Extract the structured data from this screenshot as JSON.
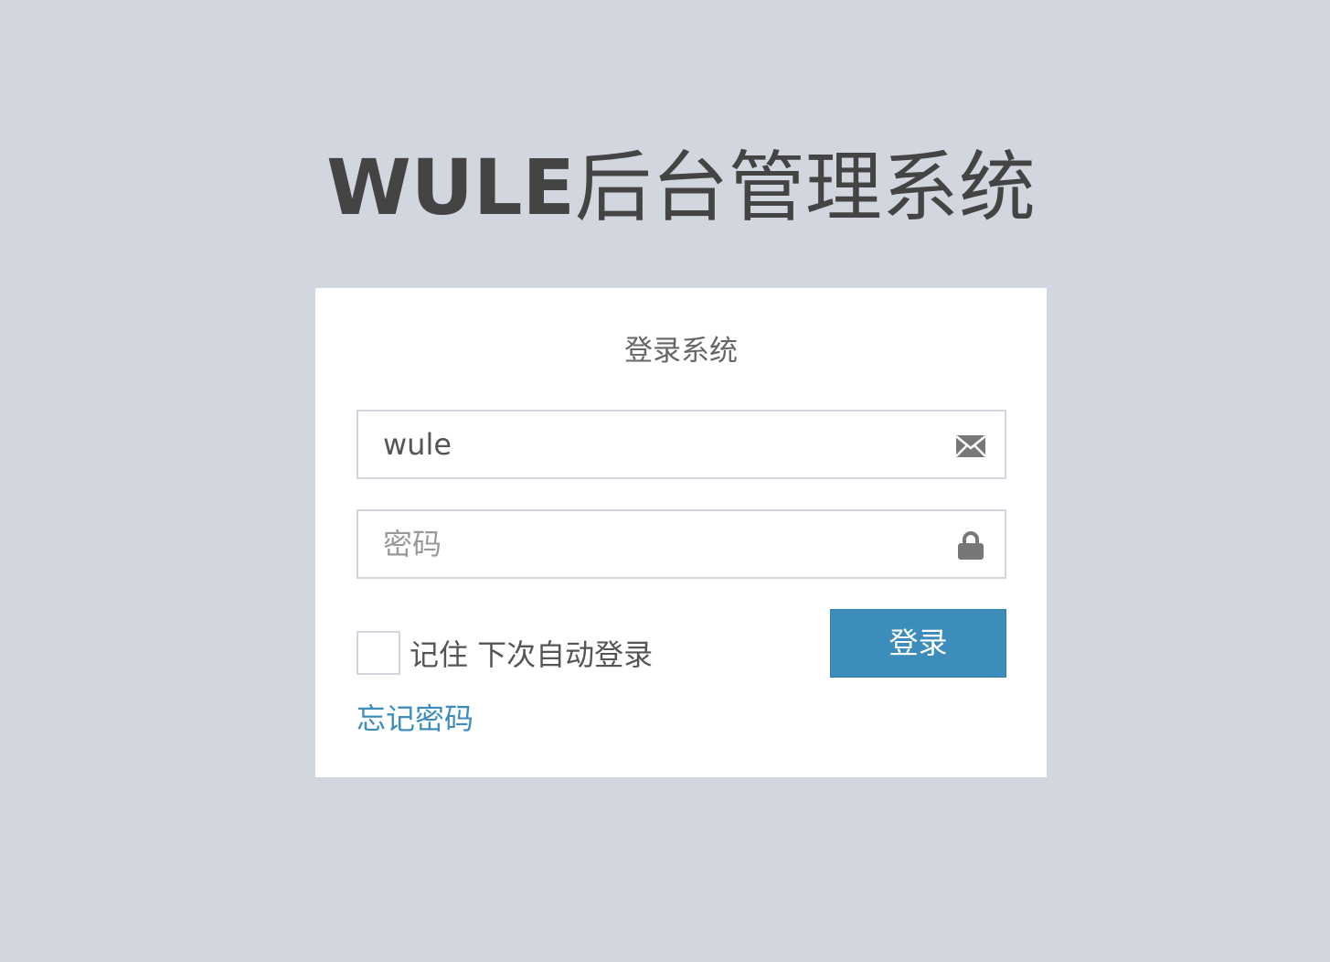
{
  "logo": {
    "bold": "WULE",
    "light": "后台管理系统"
  },
  "form": {
    "title": "登录系统",
    "username": {
      "value": "wule",
      "icon": "envelope-icon"
    },
    "password": {
      "value": "",
      "placeholder": "密码",
      "icon": "lock-icon"
    },
    "remember": {
      "label": "记住 下次自动登录",
      "checked": false
    },
    "login_label": "登录",
    "forgot_label": "忘记密码"
  },
  "colors": {
    "background": "#d2d6de",
    "card": "#ffffff",
    "primary": "#3c8dbc",
    "link": "#3c8dbc",
    "title_text": "#444444"
  }
}
